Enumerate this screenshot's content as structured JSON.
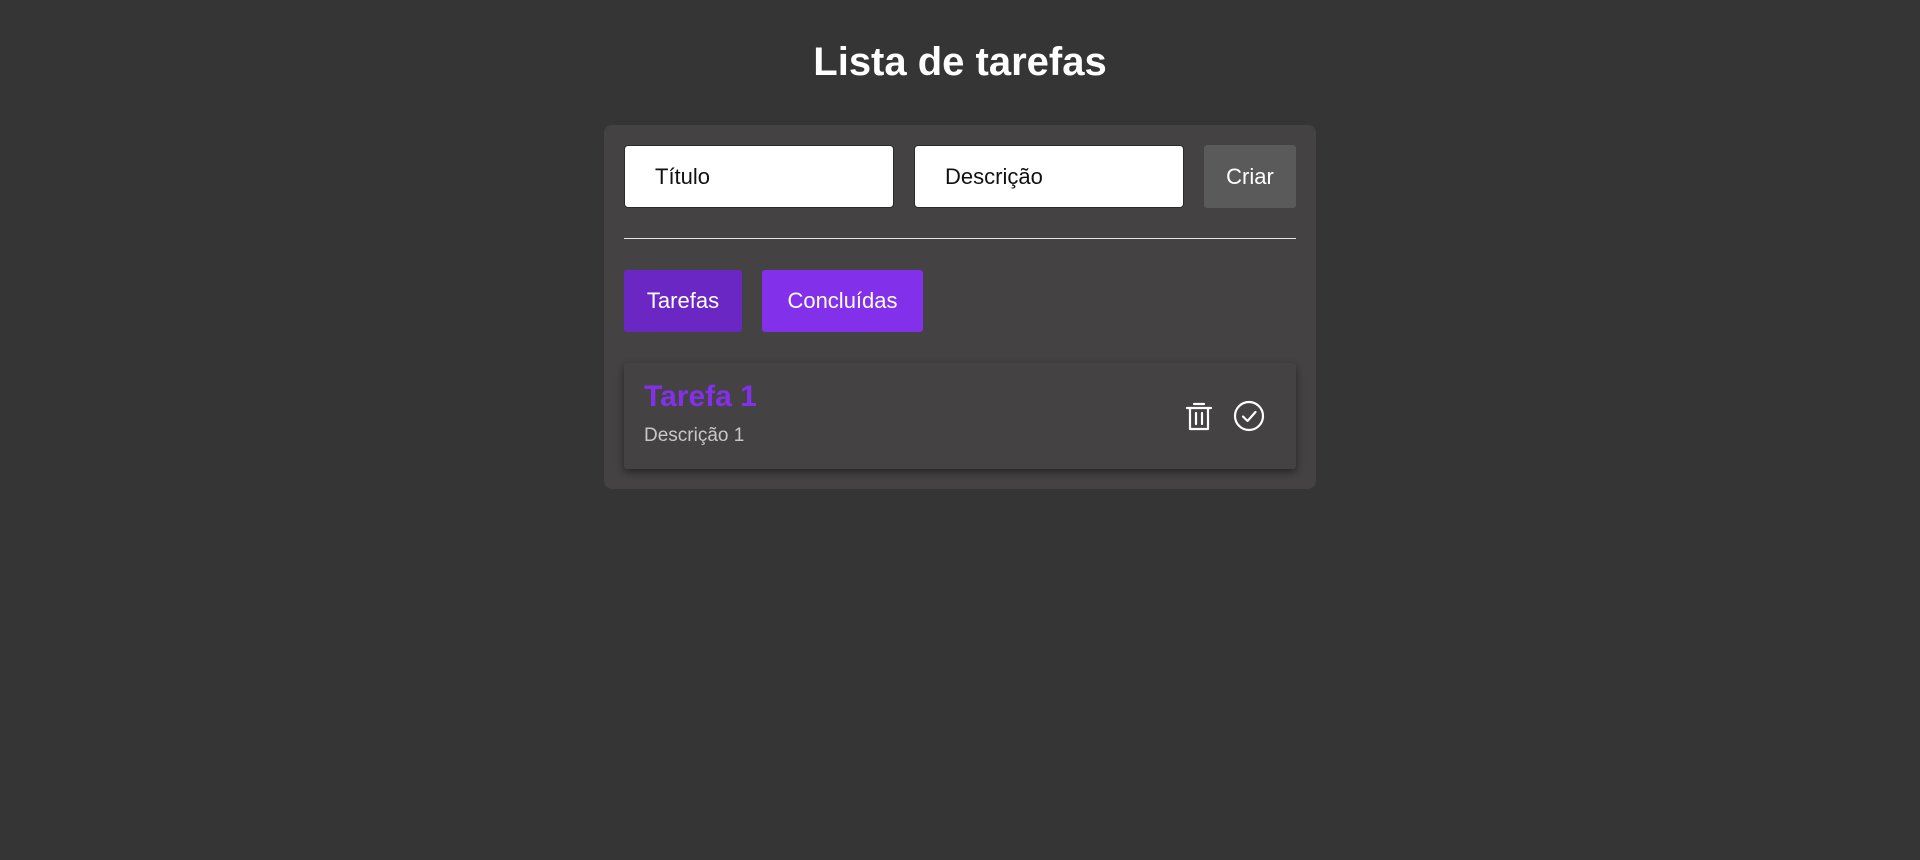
{
  "header": {
    "title": "Lista de tarefas"
  },
  "form": {
    "title_placeholder": "Título",
    "title_value": "",
    "description_placeholder": "Descrição",
    "description_value": "",
    "create_label": "Criar"
  },
  "tabs": [
    {
      "label": "Tarefas",
      "active": true
    },
    {
      "label": "Concluídas",
      "active": false
    }
  ],
  "tasks": [
    {
      "title": "Tarefa 1",
      "description": "Descrição 1",
      "actions": {
        "delete_icon": "trash-icon",
        "complete_icon": "check-circle-icon"
      }
    }
  ],
  "colors": {
    "background": "#353535",
    "card": "#444243",
    "accent": "#8330ea",
    "accent_active": "#6a27c4",
    "button_neutral": "#5a5a5a"
  }
}
